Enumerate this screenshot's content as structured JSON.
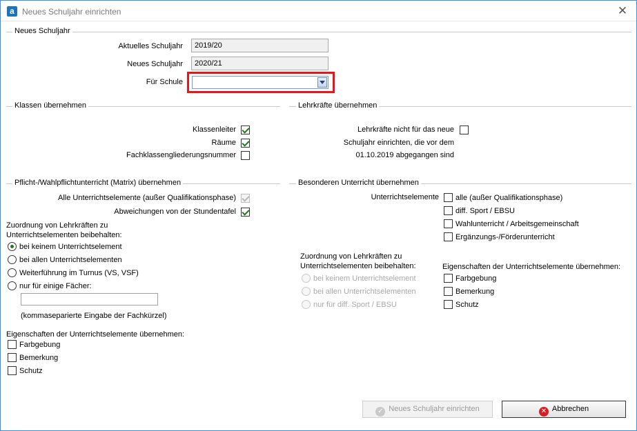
{
  "window": {
    "title": "Neues Schuljahr einrichten",
    "app_icon": "a",
    "close_glyph": "✕"
  },
  "section_new_year": {
    "legend": "Neues Schuljahr",
    "current_label": "Aktuelles Schuljahr",
    "current_value": "2019/20",
    "new_label": "Neues Schuljahr",
    "new_value": "2020/21",
    "school_label": "Für Schule",
    "school_value": ""
  },
  "section_classes": {
    "legend": "Klassen übernehmen",
    "items": [
      {
        "label": "Klassenleiter",
        "checked": true
      },
      {
        "label": "Räume",
        "checked": true
      },
      {
        "label": "Fachklassengliederungsnummer",
        "checked": false
      }
    ]
  },
  "section_teachers": {
    "legend": "Lehrkräfte übernehmen",
    "line1": "Lehrkräfte nicht für das neue",
    "line2": "Schuljahr einrichten, die vor dem",
    "line3": "01.10.2019 abgegangen sind",
    "checked": false
  },
  "section_mandatory": {
    "legend": "Pflicht-/Wahlpflichtunterricht (Matrix) übernehmen",
    "all_elements_label": "Alle Unterrichtselemente (außer Qualifikationsphase)",
    "deviations_label": "Abweichungen von der Stundentafel",
    "assignment_line1": "Zuordnung von Lehrkräften zu",
    "assignment_line2": "Unterrichtselementen beibehalten:",
    "radios": [
      {
        "label": "bei keinem Unterrichtselement",
        "selected": true
      },
      {
        "label": "bei allen Unterrichtselementen",
        "selected": false
      },
      {
        "label": "Weiterführung im Turnus (VS, VSF)",
        "selected": false
      },
      {
        "label": "nur für einige Fächer:",
        "selected": false
      }
    ],
    "subjects_value": "",
    "subjects_hint": "(kommaseparierte Eingabe der Fachkürzel)",
    "properties_label": "Eigenschaften der Unterrichtselemente übernehmen:",
    "properties": [
      {
        "label": "Farbgebung",
        "checked": false
      },
      {
        "label": "Bemerkung",
        "checked": false
      },
      {
        "label": "Schutz",
        "checked": false
      }
    ]
  },
  "section_special": {
    "legend": "Besonderen Unterricht übernehmen",
    "elements_label": "Unterrichtselemente",
    "elements": [
      {
        "label": "alle (außer Qualifikationsphase)",
        "checked": false
      },
      {
        "label": "diff. Sport / EBSU",
        "checked": false
      },
      {
        "label": "Wahlunterricht / Arbeitsgemeinschaft",
        "checked": false
      },
      {
        "label": "Ergänzungs-/Förderunterricht",
        "checked": false
      }
    ],
    "assignment_line1": "Zuordnung von Lehrkräften zu",
    "assignment_line2": "Unterrichtselementen beibehalten:",
    "radios": [
      {
        "label": "bei keinem Unterrichtselement"
      },
      {
        "label": "bei allen Unterrichtselementen"
      },
      {
        "label": "nur für diff. Sport / EBSU"
      }
    ],
    "properties_label": "Eigenschaften der Unterrichtselemente übernehmen:",
    "properties": [
      {
        "label": "Farbgebung",
        "checked": false
      },
      {
        "label": "Bemerkung",
        "checked": false
      },
      {
        "label": "Schutz",
        "checked": false
      }
    ]
  },
  "buttons": {
    "create_label": "Neues Schuljahr einrichten",
    "cancel_label": "Abbrechen",
    "create_icon": "✓",
    "cancel_icon": "✕"
  }
}
